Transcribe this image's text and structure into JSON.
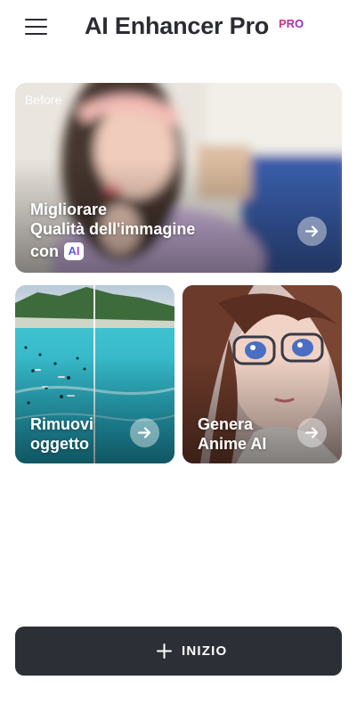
{
  "header": {
    "title": "AI Enhancer Pro",
    "badge": "PRO",
    "menu_icon": "hamburger-menu-icon"
  },
  "cards": {
    "enhance": {
      "corner_label": "Before",
      "title_line1": "Migliorare",
      "title_line2": "Qualità dell'immagine",
      "title_line3": "con",
      "ai_chip": "AI",
      "arrow_icon": "arrow-right-icon"
    },
    "remove": {
      "title_line1": "Rimuovi",
      "title_line2": "oggetto",
      "arrow_icon": "arrow-right-icon"
    },
    "anime": {
      "title_line1": "Genera",
      "title_line2": "Anime AI",
      "arrow_icon": "arrow-right-icon"
    }
  },
  "footer": {
    "start_label": "INIZIO",
    "start_icon": "plus-icon"
  },
  "colors": {
    "text_dark": "#2b2c33",
    "button_dark": "#2d2f37",
    "pro_gradient_start": "#e0356f",
    "pro_gradient_end": "#8a2bd6"
  }
}
